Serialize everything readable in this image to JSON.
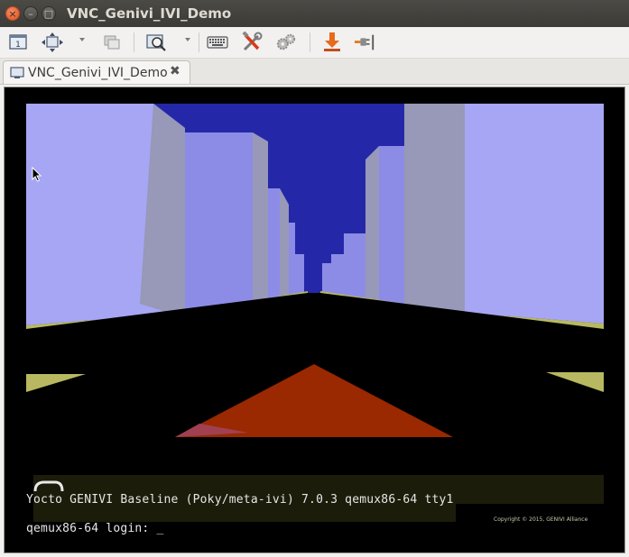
{
  "window": {
    "title": "VNC_Genivi_IVI_Demo",
    "controls": {
      "close_glyph": "×",
      "minimize_glyph": "–",
      "maximize_glyph": "□"
    }
  },
  "toolbar": {
    "buttons": [
      {
        "name": "tab-bar-icon"
      },
      {
        "name": "move-icon",
        "has_dropdown": true
      },
      {
        "name": "windows-icon"
      },
      {
        "name": "zoom-icon",
        "has_dropdown": true
      },
      {
        "name": "keyboard-icon"
      },
      {
        "name": "tools-icon"
      },
      {
        "name": "settings-gears-icon"
      },
      {
        "name": "download-icon"
      },
      {
        "name": "disconnect-plug-icon"
      }
    ]
  },
  "tabs": [
    {
      "label": "VNC_Genivi_IVI_Demo",
      "close_glyph": "✖"
    }
  ],
  "remote": {
    "colors": {
      "sky": "#2428a8",
      "building_light": "#a6a6f4",
      "building_mid": "#8c8ce6",
      "building_grey": "#9898b8",
      "curb": "#b8b860",
      "car": "#9a2800",
      "car_shade": "#a04050"
    },
    "console": {
      "banner": "Yocto GENIVI Baseline (Poky/meta-ivi) 7.0.3 qemux86-64 tty1",
      "login_prompt": "qemux86-64 login: _",
      "copyright": "Copyright © 2015, GENIVI Alliance"
    }
  }
}
